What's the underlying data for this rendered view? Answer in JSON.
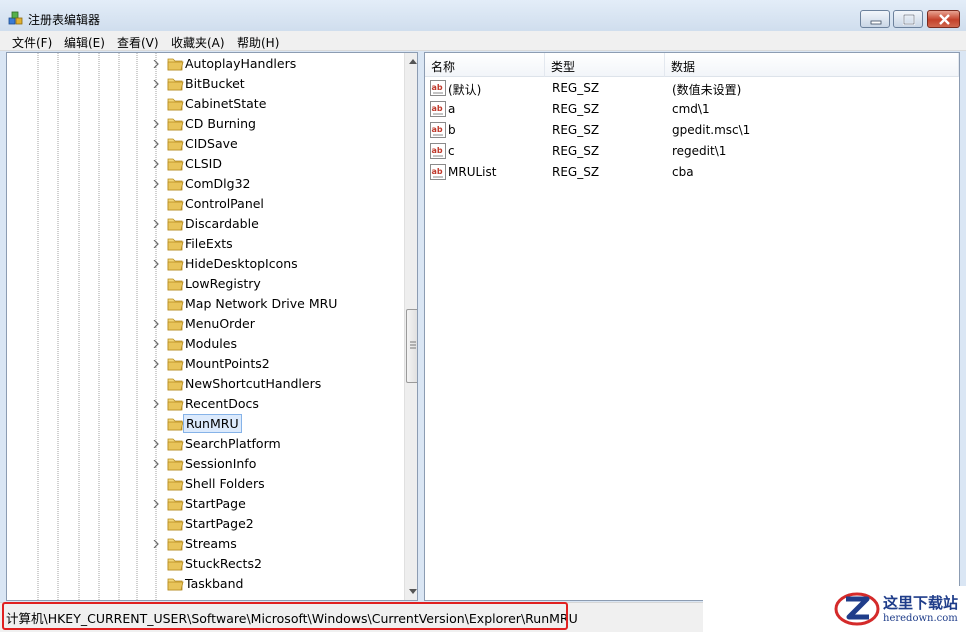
{
  "window": {
    "title": "注册表编辑器",
    "icon": "regedit-icon",
    "controls": [
      "minimize",
      "maximize",
      "close"
    ]
  },
  "menu": [
    "文件(F)",
    "编辑(E)",
    "查看(V)",
    "收藏夹(A)",
    "帮助(H)"
  ],
  "tree": {
    "items": [
      {
        "label": "AutoplayHandlers",
        "expandable": true
      },
      {
        "label": "BitBucket",
        "expandable": true
      },
      {
        "label": "CabinetState",
        "expandable": false
      },
      {
        "label": "CD Burning",
        "expandable": true
      },
      {
        "label": "CIDSave",
        "expandable": true
      },
      {
        "label": "CLSID",
        "expandable": true
      },
      {
        "label": "ComDlg32",
        "expandable": true
      },
      {
        "label": "ControlPanel",
        "expandable": false
      },
      {
        "label": "Discardable",
        "expandable": true
      },
      {
        "label": "FileExts",
        "expandable": true
      },
      {
        "label": "HideDesktopIcons",
        "expandable": true
      },
      {
        "label": "LowRegistry",
        "expandable": false
      },
      {
        "label": "Map Network Drive MRU",
        "expandable": false
      },
      {
        "label": "MenuOrder",
        "expandable": true
      },
      {
        "label": "Modules",
        "expandable": true
      },
      {
        "label": "MountPoints2",
        "expandable": true
      },
      {
        "label": "NewShortcutHandlers",
        "expandable": false
      },
      {
        "label": "RecentDocs",
        "expandable": true
      },
      {
        "label": "RunMRU",
        "expandable": false,
        "selected": true
      },
      {
        "label": "SearchPlatform",
        "expandable": true
      },
      {
        "label": "SessionInfo",
        "expandable": true
      },
      {
        "label": "Shell Folders",
        "expandable": false
      },
      {
        "label": "StartPage",
        "expandable": true
      },
      {
        "label": "StartPage2",
        "expandable": false
      },
      {
        "label": "Streams",
        "expandable": true
      },
      {
        "label": "StuckRects2",
        "expandable": false
      },
      {
        "label": "Taskband",
        "expandable": false
      }
    ]
  },
  "list": {
    "columns": [
      "名称",
      "类型",
      "数据"
    ],
    "rows": [
      {
        "name": "(默认)",
        "type": "REG_SZ",
        "data": "(数值未设置)"
      },
      {
        "name": "a",
        "type": "REG_SZ",
        "data": "cmd\\1"
      },
      {
        "name": "b",
        "type": "REG_SZ",
        "data": "gpedit.msc\\1"
      },
      {
        "name": "c",
        "type": "REG_SZ",
        "data": "regedit\\1"
      },
      {
        "name": "MRUList",
        "type": "REG_SZ",
        "data": "cba"
      }
    ]
  },
  "status": {
    "path": "计算机\\HKEY_CURRENT_USER\\Software\\Microsoft\\Windows\\CurrentVersion\\Explorer\\RunMRU",
    "highlight_color": "#e02020"
  },
  "watermark": {
    "title": "这里下载站",
    "subtitle": "heredown.com"
  },
  "colors": {
    "folder": "#e8c45a",
    "selection": "#dceafc",
    "titlebar": "#dae6f4"
  }
}
